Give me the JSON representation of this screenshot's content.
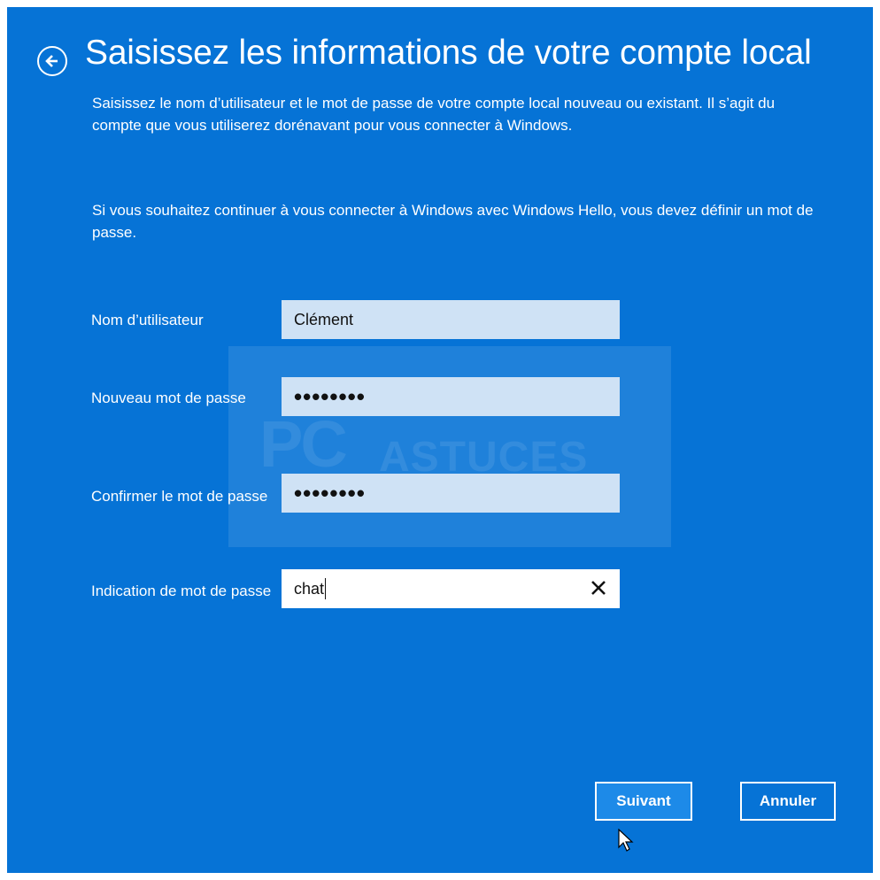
{
  "header": {
    "back_icon": "arrow-left-circle-icon",
    "title": "Saisissez les informations de votre compte local"
  },
  "intro": {
    "paragraph1": "Saisissez le nom d’utilisateur et le mot de passe de votre compte local nouveau ou existant. Il s’agit du compte que vous utiliserez dorénavant pour vous connecter à Windows.",
    "paragraph2": "Si vous souhaitez continuer à vous connecter à Windows avec Windows Hello, vous devez définir un mot de passe."
  },
  "form": {
    "username": {
      "label": "Nom d’utilisateur",
      "value": "Clément"
    },
    "new_password": {
      "label": "Nouveau mot de passe",
      "value": "••••••••"
    },
    "confirm_password": {
      "label": "Confirmer le mot de passe",
      "value": "••••••••"
    },
    "hint": {
      "label": "Indication de mot de passe",
      "value": "chat",
      "clear_icon": "close-icon"
    }
  },
  "watermark": {
    "part1": "PC",
    "part2": "ASTUCES"
  },
  "buttons": {
    "next": "Suivant",
    "cancel": "Annuler"
  },
  "colors": {
    "background": "#0673d6",
    "field": "#cfe2f5",
    "field_active": "#ffffff",
    "text": "#ffffff"
  }
}
